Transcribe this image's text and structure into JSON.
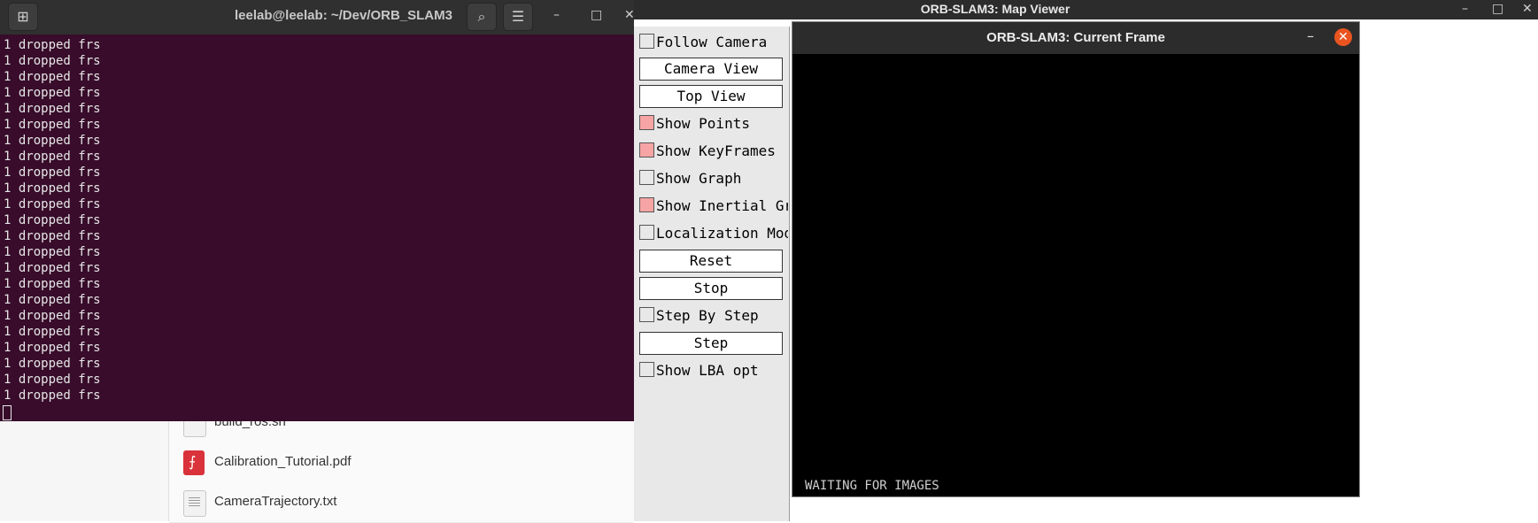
{
  "file_manager": {
    "files": [
      {
        "name": "build_ros.sh",
        "icon": "script-file-icon"
      },
      {
        "name": "Calibration_Tutorial.pdf",
        "icon": "pdf-file-icon"
      },
      {
        "name": "CameraTrajectory.txt",
        "icon": "text-file-icon"
      }
    ]
  },
  "terminal": {
    "title": "leelab@leelab: ~/Dev/ORB_SLAM3",
    "lines": [
      "1 dropped frs",
      "1 dropped frs",
      "1 dropped frs",
      "1 dropped frs",
      "1 dropped frs",
      "1 dropped frs",
      "1 dropped frs",
      "1 dropped frs",
      "1 dropped frs",
      "1 dropped frs",
      "1 dropped frs",
      "1 dropped frs",
      "1 dropped frs",
      "1 dropped frs",
      "1 dropped frs",
      "1 dropped frs",
      "1 dropped frs",
      "1 dropped frs",
      "1 dropped frs",
      "1 dropped frs",
      "1 dropped frs",
      "1 dropped frs",
      "1 dropped frs"
    ],
    "new_tab_glyph": "⊞",
    "search_glyph": "⌕",
    "menu_glyph": "☰",
    "minimize_glyph": "–",
    "maximize_glyph": "□",
    "close_glyph": "✕"
  },
  "map_viewer": {
    "title": "ORB-SLAM3: Map Viewer",
    "minimize_glyph": "–",
    "maximize_glyph": "□",
    "close_glyph": "✕",
    "panel": {
      "follow_camera": "Follow Camera",
      "camera_view": "Camera View",
      "top_view": "Top View",
      "show_points": "Show Points",
      "show_keyframes": "Show KeyFrames",
      "show_graph": "Show Graph",
      "show_inertial_graph": "Show Inertial Graph",
      "localization_mode": "Localization Mode",
      "reset": "Reset",
      "stop": "Stop",
      "step_by_step": "Step By Step",
      "step": "Step",
      "show_lba_opt": "Show LBA opt"
    },
    "checked_color": "#f7a4a4"
  },
  "current_frame": {
    "title": "ORB-SLAM3: Current Frame",
    "status": "WAITING FOR IMAGES",
    "minimize_glyph": "–",
    "close_glyph": "✕"
  }
}
